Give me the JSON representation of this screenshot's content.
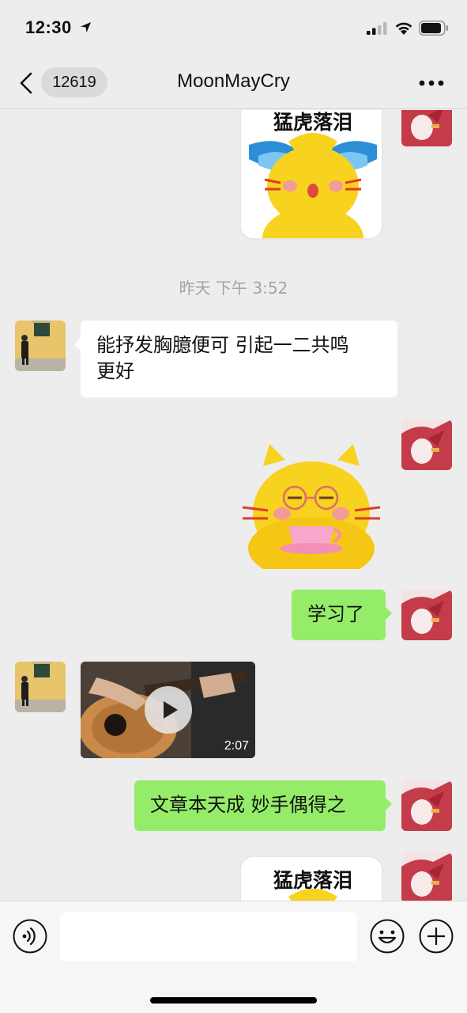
{
  "status_bar": {
    "time": "12:30"
  },
  "nav": {
    "badge": "12619",
    "title": "MoonMayCry"
  },
  "chat": {
    "timestamp": "昨天 下午 3:52",
    "sticker_caption": "猛虎落泪",
    "messages": [
      {
        "side": "left",
        "type": "text",
        "line1": "能抒发胸臆便可 引起一二共鸣",
        "line2": "更好"
      },
      {
        "side": "right",
        "type": "text",
        "text": "学习了"
      },
      {
        "side": "left",
        "type": "video",
        "duration": "2:07"
      },
      {
        "side": "right",
        "type": "text",
        "text": "文章本天成 妙手偶得之"
      }
    ]
  },
  "input": {
    "placeholder": ""
  },
  "colors": {
    "background": "#ededed",
    "bubble_green": "#95ec69",
    "bubble_white": "#ffffff",
    "sticker_yellow": "#f7d21f"
  }
}
